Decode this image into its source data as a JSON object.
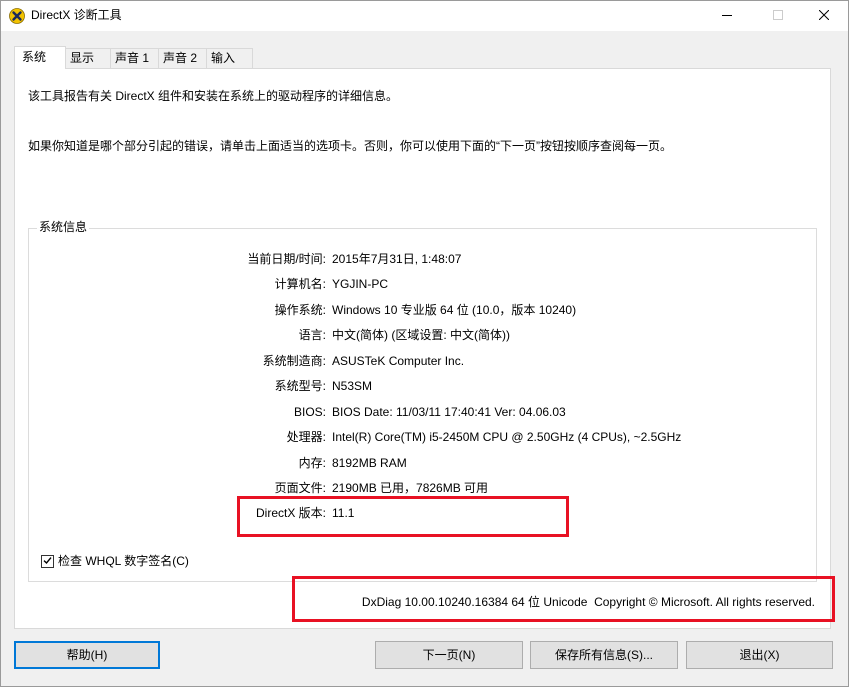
{
  "window": {
    "title": "DirectX 诊断工具",
    "icon": "directx-icon",
    "controls": {
      "minimize": "minimize-icon",
      "maximize": "maximize-icon",
      "close": "close-icon"
    }
  },
  "tabs": {
    "active": 0,
    "items": [
      {
        "label": "系统"
      },
      {
        "label": "显示"
      },
      {
        "label": "声音 1"
      },
      {
        "label": "声音 2"
      },
      {
        "label": "输入"
      }
    ]
  },
  "intro": {
    "line1": "该工具报告有关 DirectX 组件和安装在系统上的驱动程序的详细信息。",
    "line2": "如果你知道是哪个部分引起的错误，请单击上面适当的选项卡。否则，你可以使用下面的“下一页”按钮按顺序查阅每一页。"
  },
  "system_info": {
    "title": "系统信息",
    "rows": [
      {
        "label": "当前日期/时间:",
        "value": "2015年7月31日, 1:48:07"
      },
      {
        "label": "计算机名:",
        "value": "YGJIN-PC"
      },
      {
        "label": "操作系统:",
        "value": "Windows 10 专业版 64 位 (10.0，版本 10240)"
      },
      {
        "label": "语言:",
        "value": "中文(简体) (区域设置: 中文(简体))"
      },
      {
        "label": "系统制造商:",
        "value": "ASUSTeK Computer Inc."
      },
      {
        "label": "系统型号:",
        "value": "N53SM"
      },
      {
        "label": "BIOS:",
        "value": "BIOS Date: 11/03/11 17:40:41 Ver: 04.06.03"
      },
      {
        "label": "处理器:",
        "value": "Intel(R) Core(TM) i5-2450M CPU @ 2.50GHz (4 CPUs), ~2.5GHz"
      },
      {
        "label": "内存:",
        "value": "8192MB RAM"
      },
      {
        "label": "页面文件:",
        "value": "2190MB 已用，7826MB 可用"
      },
      {
        "label": "DirectX 版本:",
        "value": "11.1"
      }
    ]
  },
  "whql_check": {
    "label": "检查 WHQL 数字签名(C)",
    "checked": true
  },
  "status_text": "DxDiag 10.00.10240.16384 64 位 Unicode  Copyright © Microsoft. All rights reserved.",
  "buttons": {
    "help": "帮助(H)",
    "next": "下一页(N)",
    "save_all": "保存所有信息(S)...",
    "exit": "退出(X)"
  },
  "colors": {
    "highlight": "#e81123",
    "focus_accent": "#0078d7",
    "window_bg": "#f0f0f0",
    "panel_bg": "#ffffff"
  }
}
